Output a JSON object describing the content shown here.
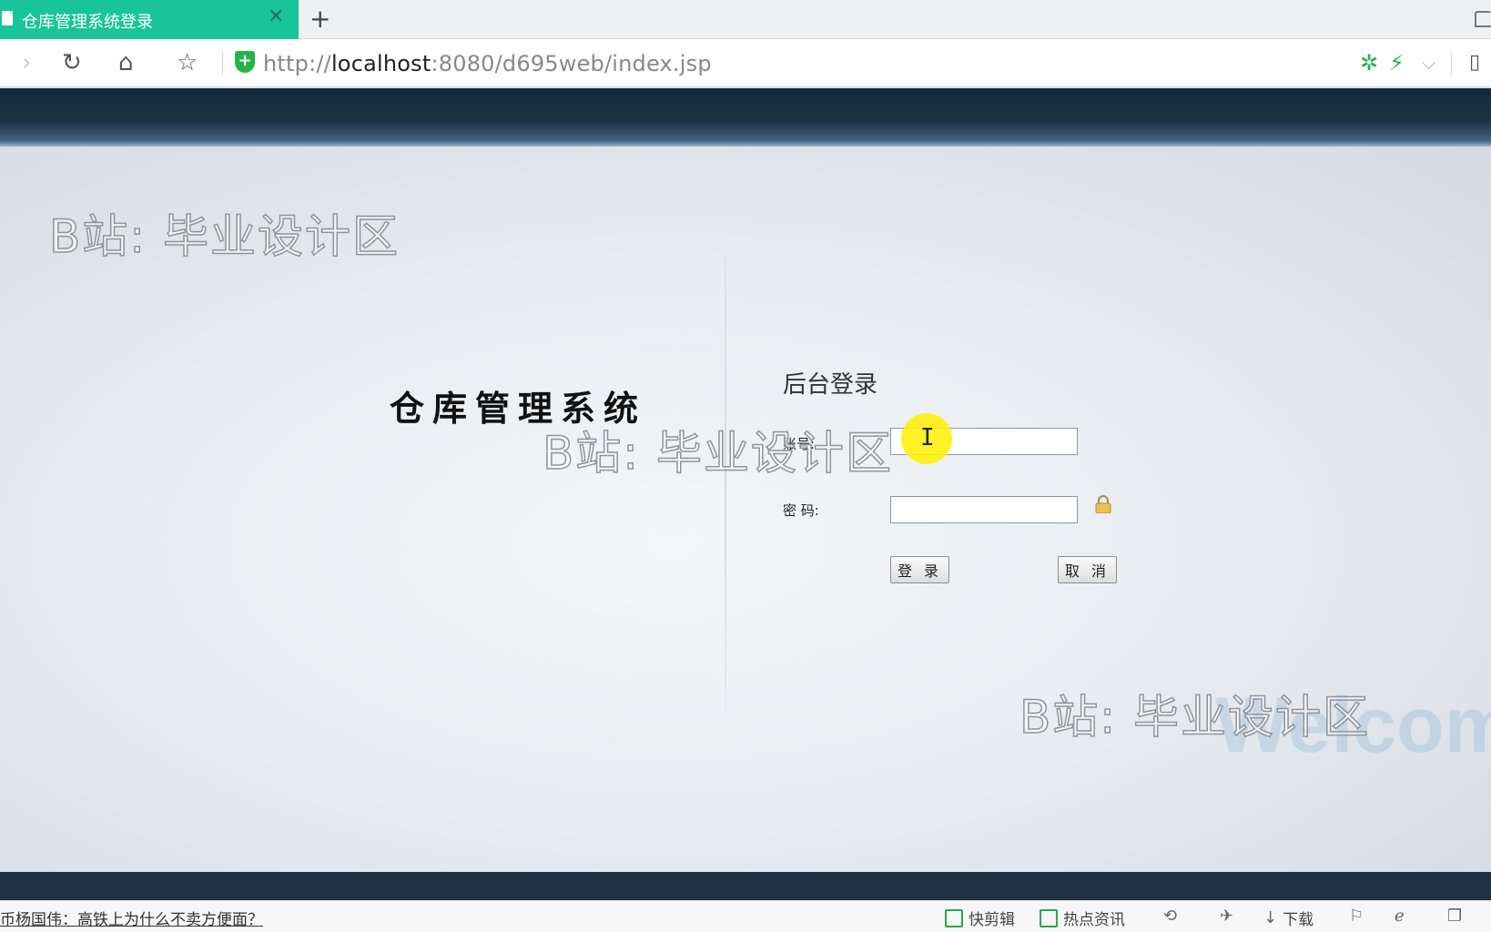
{
  "browser": {
    "tab_title": "仓库管理系统登录",
    "tab_close": "✕",
    "new_tab": "+",
    "url_prefix": "http://",
    "url_host": "localhost",
    "url_rest": ":8080/d695web/index.jsp"
  },
  "page": {
    "system_title": "仓库管理系统",
    "login_title": "后台登录",
    "username_label": "账号:",
    "username_value": "",
    "password_label": "密 码:",
    "password_value": "",
    "login_button": "登 录",
    "cancel_button": "取 消",
    "watermark_text": "B站: 毕业设计区",
    "background_text": "Welcome"
  },
  "statusbar": {
    "news_link": "币杨国伟：高铁上为什么不卖方便面？",
    "items": [
      "快剪辑",
      "热点资讯",
      "下载"
    ]
  },
  "colors": {
    "tab_active": "#19c49a",
    "header_band": "#1b3146",
    "accent_green": "#27b24a",
    "cursor_highlight": "#fff000"
  }
}
